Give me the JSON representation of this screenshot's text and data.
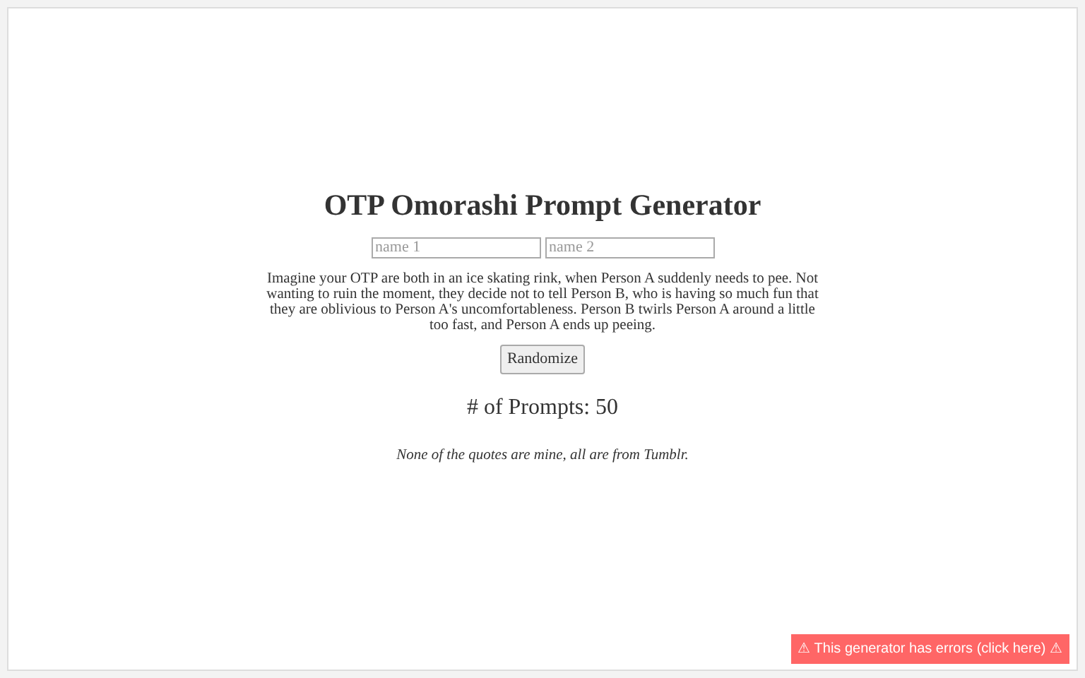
{
  "title": "OTP Omorashi Prompt Generator",
  "name_fields": [
    {
      "placeholder": "name 1"
    },
    {
      "placeholder": "name 2"
    }
  ],
  "prompt": "Imagine your OTP are both in an ice skating rink, when Person A suddenly needs to pee. Not wanting to ruin the moment, they decide not to tell Person B, who is having so much fun that they are oblivious to Person A's uncomfortableness. Person B twirls Person A around a little too fast, and Person A ends up peeing.",
  "randomize_button": "Randomize",
  "prompt_count": "# of Prompts: 50",
  "note": "None of the quotes are mine, all are from Tumblr.",
  "error_banner": "⚠ This generator has errors (click here) ⚠"
}
